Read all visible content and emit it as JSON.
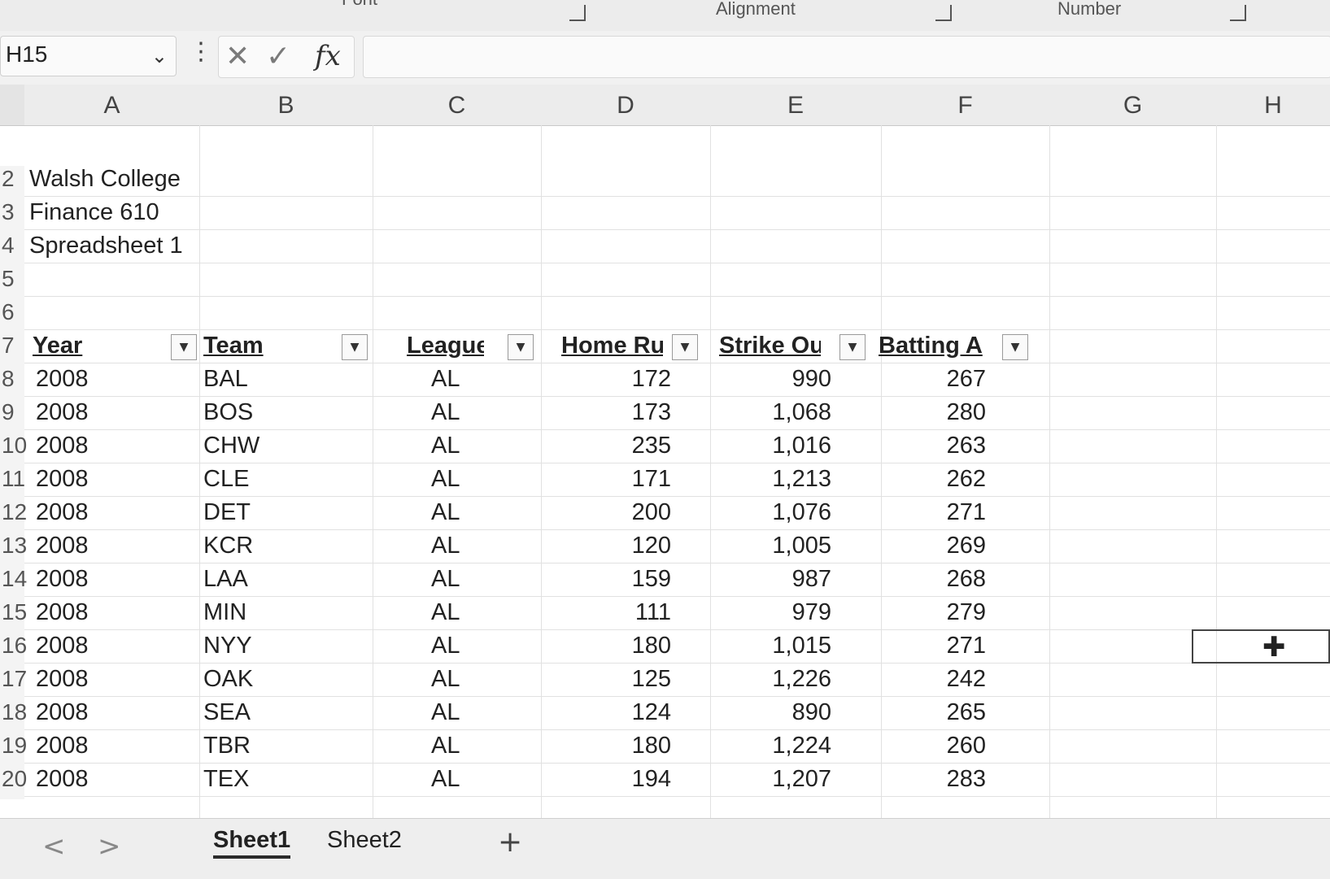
{
  "ribbon": {
    "group_left": "Font",
    "group_alignment": "Alignment",
    "group_number": "Number"
  },
  "formula_bar": {
    "name_box": "H15",
    "fx": "fx",
    "cancel": "✕",
    "enter": "✓",
    "formula_value": ""
  },
  "columns": [
    "A",
    "B",
    "C",
    "D",
    "E",
    "F",
    "G",
    "H"
  ],
  "rows": [
    "2",
    "3",
    "4",
    "5",
    "6",
    "7",
    "8",
    "9",
    "10",
    "11",
    "12",
    "13",
    "14",
    "15",
    "16",
    "17",
    "18",
    "19",
    "20"
  ],
  "title_lines": [
    "Walsh College",
    "Finance 610",
    "Spreadsheet 1"
  ],
  "table": {
    "headers": [
      "Year",
      "Team",
      "League",
      "Home Ru",
      "Strike Ou",
      "Batting A"
    ],
    "rows": [
      [
        "2008",
        "BAL",
        "AL",
        "172",
        "990",
        "267"
      ],
      [
        "2008",
        "BOS",
        "AL",
        "173",
        "1,068",
        "280"
      ],
      [
        "2008",
        "CHW",
        "AL",
        "235",
        "1,016",
        "263"
      ],
      [
        "2008",
        "CLE",
        "AL",
        "171",
        "1,213",
        "262"
      ],
      [
        "2008",
        "DET",
        "AL",
        "200",
        "1,076",
        "271"
      ],
      [
        "2008",
        "KCR",
        "AL",
        "120",
        "1,005",
        "269"
      ],
      [
        "2008",
        "LAA",
        "AL",
        "159",
        "987",
        "268"
      ],
      [
        "2008",
        "MIN",
        "AL",
        "111",
        "979",
        "279"
      ],
      [
        "2008",
        "NYY",
        "AL",
        "180",
        "1,015",
        "271"
      ],
      [
        "2008",
        "OAK",
        "AL",
        "125",
        "1,226",
        "242"
      ],
      [
        "2008",
        "SEA",
        "AL",
        "124",
        "890",
        "265"
      ],
      [
        "2008",
        "TBR",
        "AL",
        "180",
        "1,224",
        "260"
      ],
      [
        "2008",
        "TEX",
        "AL",
        "194",
        "1,207",
        "283"
      ]
    ]
  },
  "sheets": {
    "tabs": [
      "Sheet1",
      "Sheet2"
    ],
    "active": "Sheet1",
    "add": "+",
    "prev": "<",
    "next": ">"
  }
}
